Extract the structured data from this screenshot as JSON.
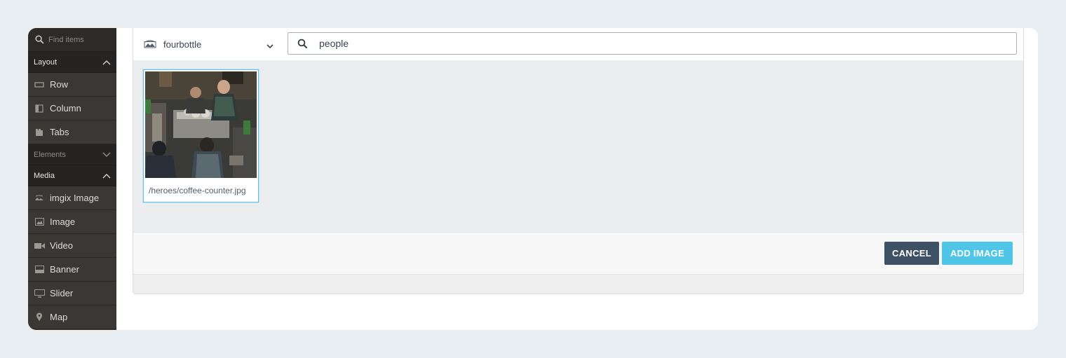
{
  "colors": {
    "page_bg": "#e8eef2",
    "sidebar_bg": "#383532",
    "section_bg": "#262422",
    "accent": "#4fc6e8",
    "cancel": "#3d5065",
    "selection_border": "#5fc3e6"
  },
  "sidebar": {
    "search_placeholder": "Find items",
    "search_icon": "search-icon",
    "sections": [
      {
        "label": "Layout",
        "state": "expanded",
        "icon": "chevron-up-icon",
        "items": [
          {
            "label": "Row",
            "icon": "row-icon"
          },
          {
            "label": "Column",
            "icon": "column-icon"
          },
          {
            "label": "Tabs",
            "icon": "tabs-icon"
          }
        ]
      },
      {
        "label": "Elements",
        "state": "collapsed",
        "icon": "chevron-down-icon",
        "items": []
      },
      {
        "label": "Media",
        "state": "expanded",
        "icon": "chevron-up-icon",
        "items": [
          {
            "label": "imgix Image",
            "icon": "imgix-image-icon"
          },
          {
            "label": "Image",
            "icon": "image-icon"
          },
          {
            "label": "Video",
            "icon": "video-icon"
          },
          {
            "label": "Banner",
            "icon": "banner-icon"
          },
          {
            "label": "Slider",
            "icon": "slider-icon"
          },
          {
            "label": "Map",
            "icon": "map-pin-icon"
          }
        ]
      }
    ]
  },
  "picker": {
    "source": {
      "name": "fourbottle",
      "icon": "imgix-source-icon",
      "dropdown_icon": "chevron-down-icon"
    },
    "search": {
      "value": "people",
      "icon": "search-icon"
    },
    "results": [
      {
        "path": "/heroes/coffee-counter.jpg",
        "selected": true
      }
    ],
    "buttons": {
      "cancel": "CANCEL",
      "add": "ADD IMAGE"
    }
  }
}
